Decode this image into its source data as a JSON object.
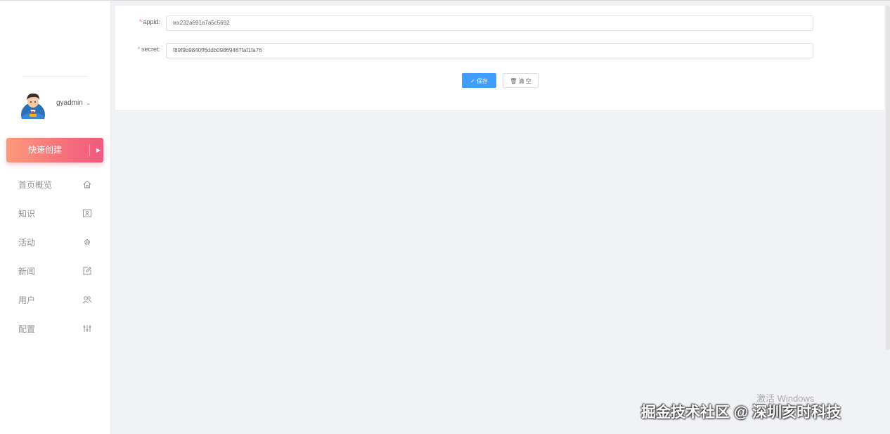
{
  "sidebar": {
    "username": "gyadmin",
    "quick_create": "快速创建",
    "menu": [
      {
        "label": "首页概览",
        "icon": "home-icon"
      },
      {
        "label": "知识",
        "icon": "id-card-icon"
      },
      {
        "label": "活动",
        "icon": "gear-icon"
      },
      {
        "label": "新闻",
        "icon": "edit-icon"
      },
      {
        "label": "用户",
        "icon": "users-icon"
      },
      {
        "label": "配置",
        "icon": "sliders-icon"
      }
    ]
  },
  "form": {
    "appid": {
      "label": "appid:",
      "value": "wx232a691a7a5c5692"
    },
    "secret": {
      "label": "secret:",
      "value": "f89f9b9840ff6ddb09869487faf1fa76"
    },
    "required_mark": "*",
    "save_label": "保存",
    "clear_label": "清 空"
  },
  "watermarks": {
    "activate": "激活 Windows",
    "site": "掘金技术社区 @ 深圳亥时科技"
  },
  "colors": {
    "primary": "#409eff",
    "quick_create_start": "#fb9a7b",
    "quick_create_end": "#ee5b7f",
    "background": "#f0f2f5"
  }
}
